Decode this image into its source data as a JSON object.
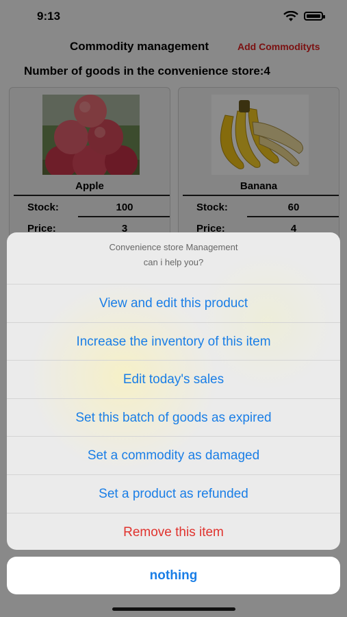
{
  "status_bar": {
    "time": "9:13"
  },
  "nav": {
    "title": "Commodity management",
    "add_label": "Add Commodityts"
  },
  "store": {
    "count_text": "Number of goods in the convenience store:4"
  },
  "products": [
    {
      "name": "Apple",
      "stock_label": "Stock:",
      "stock": "100",
      "price_label": "Price:",
      "price": "3"
    },
    {
      "name": "Banana",
      "stock_label": "Stock:",
      "stock": "60",
      "price_label": "Price:",
      "price": "4"
    }
  ],
  "action_sheet": {
    "title": "Convenience store Management",
    "message": "can i help you?",
    "actions": [
      "View and edit this product",
      "Increase the inventory of this item",
      "Edit today's sales",
      "Set this batch of goods as expired",
      "Set a commodity as damaged",
      "Set a product as refunded",
      "Remove this item"
    ],
    "cancel": "nothing"
  },
  "colors": {
    "action_blue": "#1a7ee6",
    "destructive_red": "#e0332e",
    "nav_add_red": "#e02020"
  }
}
